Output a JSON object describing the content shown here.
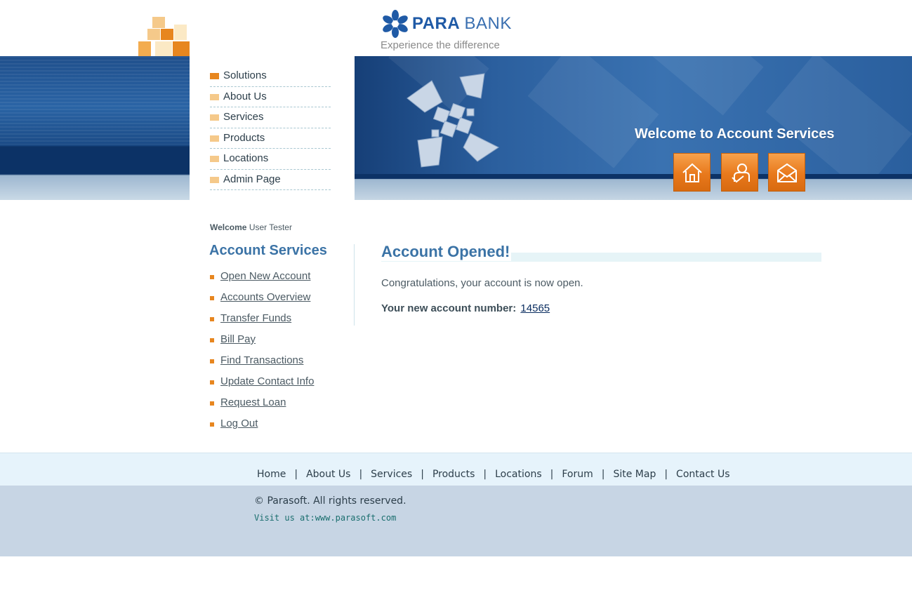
{
  "brand": {
    "name_bold": "PARA",
    "name_light": "BANK",
    "tagline": "Experience the difference",
    "colors": {
      "primary_blue": "#1f4f8c",
      "accent_orange": "#e7861f",
      "heading_blue": "#3b73a6"
    }
  },
  "header": {
    "solutions_menu": [
      {
        "label": "Solutions"
      },
      {
        "label": "About Us"
      },
      {
        "label": "Services"
      },
      {
        "label": "Products"
      },
      {
        "label": "Locations"
      },
      {
        "label": "Admin Page"
      }
    ],
    "welcome_heading": "Welcome to Account Services",
    "buttons": [
      {
        "icon": "home-icon"
      },
      {
        "icon": "about-icon"
      },
      {
        "icon": "contact-envelope-icon"
      }
    ]
  },
  "sidebar": {
    "welcome_label": "Welcome",
    "user_name": "User Tester",
    "heading": "Account Services",
    "items": [
      {
        "label": "Open New Account"
      },
      {
        "label": "Accounts Overview"
      },
      {
        "label": "Transfer Funds"
      },
      {
        "label": "Bill Pay"
      },
      {
        "label": "Find Transactions"
      },
      {
        "label": "Update Contact Info"
      },
      {
        "label": "Request Loan"
      },
      {
        "label": "Log Out"
      }
    ]
  },
  "main": {
    "title": "Account Opened!",
    "message": "Congratulations, your account is now open.",
    "account_number_label": "Your new account number:",
    "account_number": "14565"
  },
  "footer": {
    "links": [
      {
        "label": "Home"
      },
      {
        "label": "About Us"
      },
      {
        "label": "Services"
      },
      {
        "label": "Products"
      },
      {
        "label": "Locations"
      },
      {
        "label": "Forum"
      },
      {
        "label": "Site Map"
      },
      {
        "label": "Contact Us"
      }
    ],
    "separator": "|",
    "copyright": "© Parasoft. All rights reserved.",
    "visit": "Visit us at:www.parasoft.com"
  }
}
